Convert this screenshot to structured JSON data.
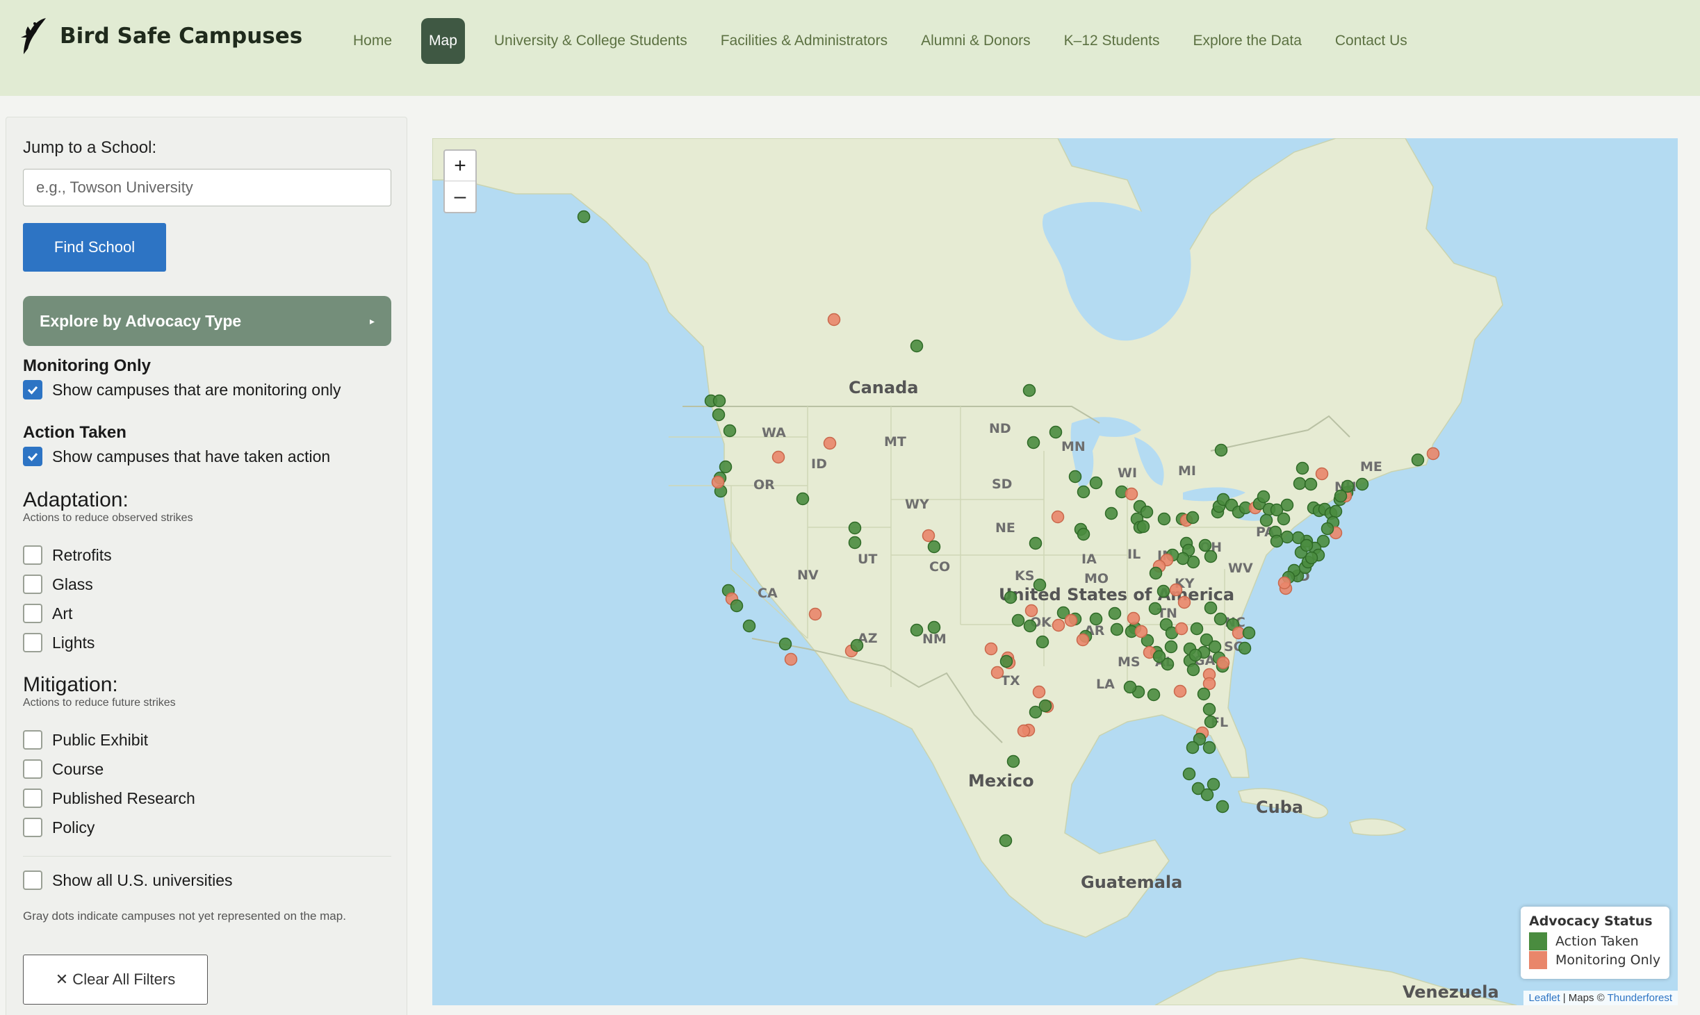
{
  "header": {
    "brand": "Bird Safe Campuses",
    "nav": [
      "Home",
      "Map",
      "University & College Students",
      "Facilities & Administrators",
      "Alumni & Donors",
      "K–12 Students",
      "Explore the Data",
      "Contact Us"
    ],
    "active_nav": "Map"
  },
  "sidebar": {
    "jump_label": "Jump to a School:",
    "search_placeholder": "e.g., Towson University",
    "find_button": "Find School",
    "advocacy_button": "Explore by Advocacy Type",
    "monitoring": {
      "title": "Monitoring Only",
      "label": "Show campuses that are monitoring only",
      "checked": true
    },
    "action": {
      "title": "Action Taken",
      "label": "Show campuses that have taken action",
      "checked": true
    },
    "adaptation": {
      "title": "Adaptation:",
      "subtitle": "Actions to reduce observed strikes",
      "options": [
        "Retrofits",
        "Glass",
        "Art",
        "Lights"
      ]
    },
    "mitigation": {
      "title": "Mitigation:",
      "subtitle": "Actions to reduce future strikes",
      "options": [
        "Public Exhibit",
        "Course",
        "Published Research",
        "Policy"
      ]
    },
    "show_all": "Show all U.S. universities",
    "note": "Gray dots indicate campuses not yet represented on the map.",
    "clear_button": "✕ Clear All Filters"
  },
  "map": {
    "zoom_in": "+",
    "zoom_out": "–",
    "labels": {
      "country": [
        "Canada",
        "United States of America",
        "Mexico",
        "Cuba",
        "Guatemala",
        "Venezuela"
      ],
      "states": [
        "WA",
        "OR",
        "ID",
        "MT",
        "ND",
        "MN",
        "SD",
        "WY",
        "NE",
        "CA",
        "NV",
        "UT",
        "CO",
        "KS",
        "MO",
        "AZ",
        "NM",
        "TX",
        "OK",
        "AR",
        "MS",
        "AL",
        "GA",
        "LA",
        "TN",
        "KY",
        "OH",
        "WV",
        "MD",
        "PA",
        "NC",
        "SC",
        "FL",
        "WI",
        "MI",
        "IA",
        "IL",
        "IN",
        "ME",
        "NH"
      ]
    },
    "legend": {
      "title": "Advocacy Status",
      "action": "Action Taken",
      "monitoring": "Monitoring Only"
    },
    "colors": {
      "action": "#4a8c3f",
      "monitoring": "#e9866a",
      "water": "#b4dbf2",
      "land": "#e6ebd3"
    },
    "attribution": {
      "leaflet": "Leaflet",
      "sep": " | Maps © ",
      "provider": "Thunderforest"
    }
  }
}
